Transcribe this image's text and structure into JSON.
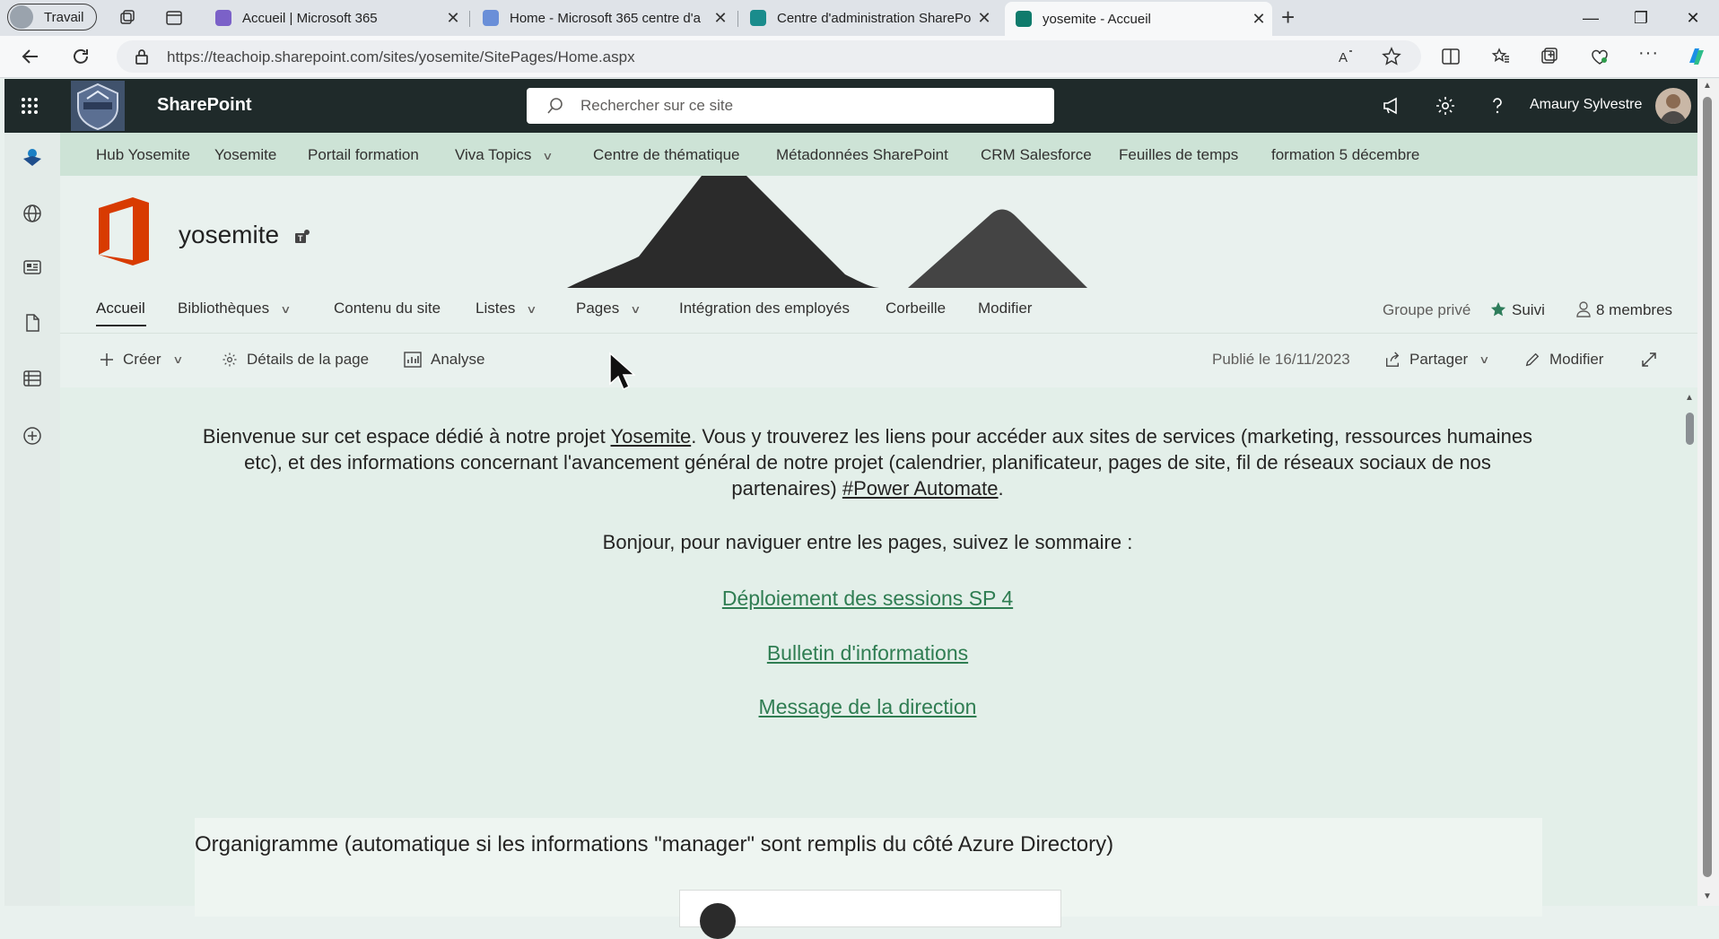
{
  "browser": {
    "profile_label": "Travail",
    "tabs": [
      {
        "title": "Accueil | Microsoft 365",
        "favicon_color": "#7b61c8"
      },
      {
        "title": "Home - Microsoft 365 centre d'a",
        "favicon_color": "#6a8fd8"
      },
      {
        "title": "Centre d'administration SharePoi",
        "favicon_color": "#1a8c8c"
      },
      {
        "title": "yosemite - Accueil",
        "favicon_color": "#0f7b6c"
      }
    ],
    "new_tab": "+",
    "url": "https://teachoip.sharepoint.com/sites/yosemite/SitePages/Home.aspx"
  },
  "suitebar": {
    "brand": "SharePoint",
    "search_placeholder": "Rechercher sur ce site",
    "user_name": "Amaury Sylvestre",
    "bg_color": "#1f2a2a"
  },
  "hubnav": {
    "items": [
      "Hub Yosemite",
      "Yosemite",
      "Portail formation",
      "Viva Topics",
      "Centre de thématique",
      "Métadonnées SharePoint",
      "CRM Salesforce",
      "Feuilles de temps",
      "formation 5 décembre"
    ],
    "bg_color": "#cde3d6"
  },
  "site": {
    "title": "yosemite",
    "nav": [
      "Accueil",
      "Bibliothèques",
      "Contenu du site",
      "Listes",
      "Pages",
      "Intégration des employés",
      "Corbeille",
      "Modifier"
    ],
    "privacy": "Groupe privé",
    "follow": "Suivi",
    "members": "8 membres"
  },
  "commandbar": {
    "create": "Créer",
    "page_details": "Détails de la page",
    "analytics": "Analyse",
    "published": "Publié le 16/11/2023",
    "share": "Partager",
    "edit": "Modifier"
  },
  "content": {
    "intro_before": "Bienvenue sur cet espace dédié à notre projet ",
    "intro_link": "Yosemite",
    "intro_after": ". Vous y trouverez les liens pour accéder aux sites de services (marketing, ressources humaines etc), et des informations concernant l'avancement général de notre projet (calendrier, planificateur, pages de site, fil de réseaux sociaux de nos partenaires) ",
    "intro_hashtag": "#Power Automate",
    "intro_end": ".",
    "greeting": "Bonjour, pour naviguer entre les pages, suivez le sommaire :",
    "toc_links": [
      "Déploiement des sessions SP 4",
      "Bulletin d'informations",
      "Message de la direction"
    ],
    "org_title": "Organigramme (automatique si les informations \"manager\" sont remplis du côté Azure Directory)",
    "link_color": "#2f7d52"
  }
}
